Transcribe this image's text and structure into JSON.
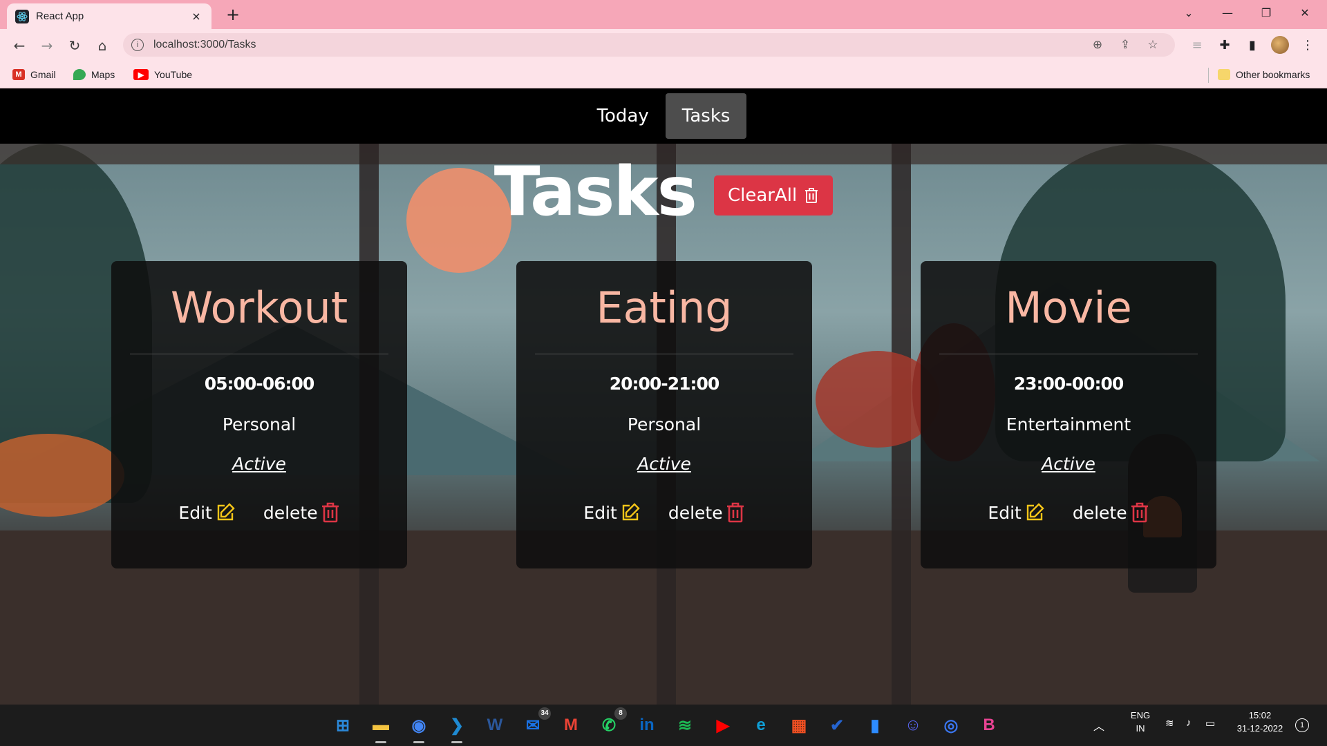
{
  "browser": {
    "tab_title": "React App",
    "tab_close": "×",
    "new_tab": "+",
    "url": "localhost:3000/Tasks",
    "bookmarks": [
      {
        "label": "Gmail",
        "icon": "gmail-icon",
        "color": "#d93025"
      },
      {
        "label": "Maps",
        "icon": "maps-icon",
        "color": "#34a853"
      },
      {
        "label": "YouTube",
        "icon": "youtube-icon",
        "color": "#ff0000"
      }
    ],
    "other_bookmarks": "Other bookmarks"
  },
  "app": {
    "nav": [
      {
        "label": "Today",
        "active": false
      },
      {
        "label": "Tasks",
        "active": true
      }
    ],
    "page_title": "Tasks",
    "clear_all_label": "ClearAll",
    "accent_color": "#dc3545",
    "title_color": "#f9b7a3",
    "tasks": [
      {
        "title": "Workout",
        "time": "05:00-06:00",
        "category": "Personal",
        "status": "Active",
        "edit_label": "Edit",
        "delete_label": "delete"
      },
      {
        "title": "Eating",
        "time": "20:00-21:00",
        "category": "Personal",
        "status": "Active",
        "edit_label": "Edit",
        "delete_label": "delete"
      },
      {
        "title": "Movie",
        "time": "23:00-00:00",
        "category": "Entertainment",
        "status": "Active",
        "edit_label": "Edit",
        "delete_label": "delete"
      }
    ]
  },
  "taskbar": {
    "apps": [
      {
        "name": "windows-start-icon",
        "color": "#2b88d8",
        "badge": ""
      },
      {
        "name": "file-explorer-icon",
        "color": "#f3c340",
        "badge": ""
      },
      {
        "name": "chrome-icon",
        "color": "#4285f4",
        "badge": ""
      },
      {
        "name": "vscode-icon",
        "color": "#1f8ad2",
        "badge": ""
      },
      {
        "name": "word-icon",
        "color": "#2b579a",
        "badge": ""
      },
      {
        "name": "mail-icon",
        "color": "#1a73e8",
        "badge": "34"
      },
      {
        "name": "gmail-icon",
        "color": "#ea4335",
        "badge": ""
      },
      {
        "name": "whatsapp-icon",
        "color": "#25d366",
        "badge": "8"
      },
      {
        "name": "linkedin-icon",
        "color": "#0a66c2",
        "badge": ""
      },
      {
        "name": "spotify-icon",
        "color": "#1db954",
        "badge": ""
      },
      {
        "name": "youtube-icon",
        "color": "#ff0000",
        "badge": ""
      },
      {
        "name": "edge-icon",
        "color": "#0f9ed5",
        "badge": ""
      },
      {
        "name": "store-icon",
        "color": "#f25022",
        "badge": ""
      },
      {
        "name": "todo-icon",
        "color": "#2564cf",
        "badge": ""
      },
      {
        "name": "zoom-icon",
        "color": "#2d8cff",
        "badge": ""
      },
      {
        "name": "discord-icon",
        "color": "#5865f2",
        "badge": ""
      },
      {
        "name": "signal-icon",
        "color": "#3a76f0",
        "badge": ""
      },
      {
        "name": "biolink-icon",
        "color": "#e84393",
        "badge": ""
      }
    ],
    "lang_top": "ENG",
    "lang_bottom": "IN",
    "time": "15:02",
    "date": "31-12-2022",
    "notification_count": "1"
  }
}
